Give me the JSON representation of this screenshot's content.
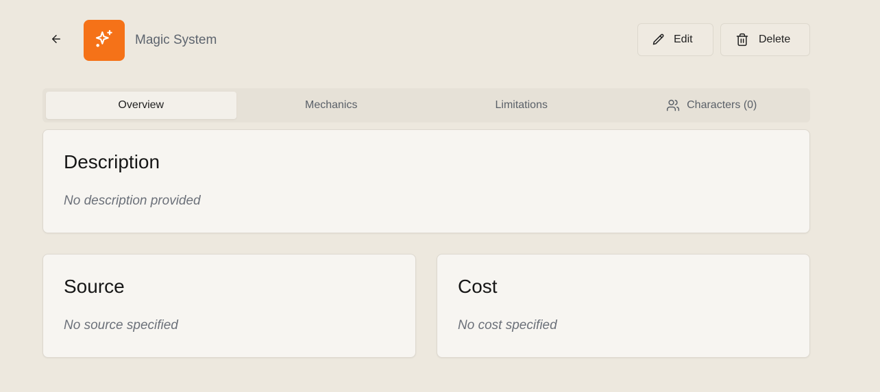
{
  "header": {
    "back_icon": "arrow-left-icon",
    "app_icon": "sparkles-icon",
    "app_icon_color": "#f57218",
    "title": "Magic System",
    "edit_label": "Edit",
    "edit_icon": "pencil-icon",
    "delete_label": "Delete",
    "delete_icon": "trash-icon"
  },
  "tabs": [
    {
      "label": "Overview",
      "active": true
    },
    {
      "label": "Mechanics",
      "active": false
    },
    {
      "label": "Limitations",
      "active": false
    },
    {
      "label": "Characters (0)",
      "active": false,
      "icon": "users-icon"
    }
  ],
  "cards": {
    "description": {
      "title": "Description",
      "empty": "No description provided"
    },
    "source": {
      "title": "Source",
      "empty": "No source specified"
    },
    "cost": {
      "title": "Cost",
      "empty": "No cost specified"
    }
  }
}
